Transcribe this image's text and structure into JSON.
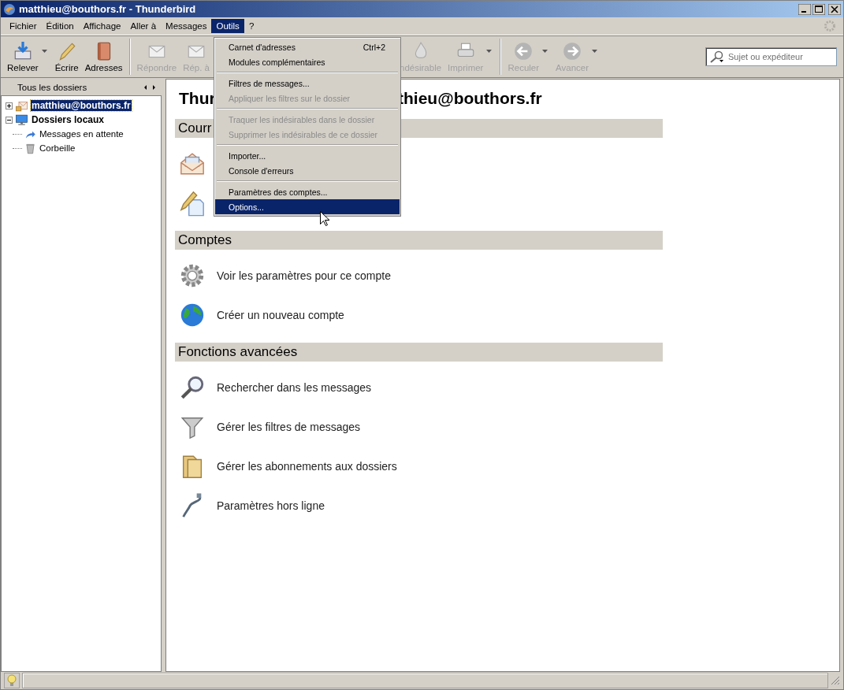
{
  "window": {
    "title": "matthieu@bouthors.fr - Thunderbird"
  },
  "menu_bar": [
    {
      "label": "Fichier",
      "selected": false
    },
    {
      "label": "Édition",
      "selected": false
    },
    {
      "label": "Affichage",
      "selected": false
    },
    {
      "label": "Aller à",
      "selected": false
    },
    {
      "label": "Messages",
      "selected": false
    },
    {
      "label": "Outils",
      "selected": true
    },
    {
      "label": "?",
      "selected": false
    }
  ],
  "toolbar_left": [
    {
      "label": "Relever",
      "kind": "get",
      "disabled": false,
      "dropdown": true,
      "separator_before": false
    },
    {
      "label": "Écrire",
      "kind": "write",
      "disabled": false,
      "dropdown": false,
      "separator_before": false
    },
    {
      "label": "Adresses",
      "kind": "book",
      "disabled": false,
      "dropdown": false,
      "separator_before": false
    },
    {
      "label": "Répondre",
      "kind": "reply",
      "disabled": true,
      "dropdown": false,
      "separator_before": true
    },
    {
      "label": "Rép. à",
      "kind": "reply",
      "disabled": true,
      "dropdown": false,
      "separator_before": false
    }
  ],
  "toolbar_right": [
    {
      "label": "ndésirable",
      "kind": "junk",
      "disabled": true,
      "dropdown": false,
      "separator_before": false
    },
    {
      "label": "Imprimer",
      "kind": "print",
      "disabled": true,
      "dropdown": true,
      "separator_before": false
    },
    {
      "label": "Reculer",
      "kind": "back",
      "disabled": true,
      "dropdown": true,
      "separator_before": true
    },
    {
      "label": "Avancer",
      "kind": "forward",
      "disabled": true,
      "dropdown": true,
      "separator_before": false
    }
  ],
  "search": {
    "placeholder": "Sujet ou expéditeur"
  },
  "folder_pane": {
    "header": "Tous les dossiers",
    "tree": [
      {
        "label": "matthieu@bouthors.fr",
        "kind": "account",
        "expanded": false,
        "selected": true
      },
      {
        "label": "Dossiers locaux",
        "kind": "local",
        "expanded": true,
        "selected": false,
        "children": [
          {
            "label": "Messages en attente",
            "kind": "outbox",
            "selected": false
          },
          {
            "label": "Corbeille",
            "kind": "trash",
            "selected": false
          }
        ]
      }
    ]
  },
  "main": {
    "title_parts": [
      "Thur",
      "thieu@bouthors.fr"
    ],
    "sections": [
      {
        "title": "Courr",
        "items": [
          {
            "kind": "mail"
          },
          {
            "kind": "compose"
          }
        ]
      },
      {
        "title": "Comptes",
        "items": [
          {
            "kind": "gear",
            "label": "Voir les paramètres pour ce compte"
          },
          {
            "kind": "globe",
            "label": "Créer un nouveau compte"
          }
        ]
      },
      {
        "title": "Fonctions avancées",
        "items": [
          {
            "kind": "search",
            "label": "Rechercher dans les messages"
          },
          {
            "kind": "filter",
            "label": "Gérer les filtres de messages"
          },
          {
            "kind": "folder",
            "label": "Gérer les abonnements aux dossiers"
          },
          {
            "kind": "offline",
            "label": "Paramètres hors ligne"
          }
        ]
      }
    ]
  },
  "tools_menu": {
    "groups": [
      [
        {
          "label": "Carnet d'adresses",
          "shortcut": "Ctrl+2",
          "disabled": false,
          "selected": false
        },
        {
          "label": "Modules complémentaires",
          "disabled": false,
          "selected": false
        }
      ],
      [
        {
          "label": "Filtres de messages...",
          "disabled": false,
          "selected": false
        },
        {
          "label": "Appliquer les filtres sur le dossier",
          "disabled": true,
          "selected": false
        }
      ],
      [
        {
          "label": "Traquer les indésirables dans le dossier",
          "disabled": true,
          "selected": false
        },
        {
          "label": "Supprimer les indésirables de ce dossier",
          "disabled": true,
          "selected": false
        }
      ],
      [
        {
          "label": "Importer...",
          "disabled": false,
          "selected": false
        },
        {
          "label": "Console d'erreurs",
          "disabled": false,
          "selected": false
        }
      ],
      [
        {
          "label": "Paramètres des comptes...",
          "disabled": false,
          "selected": false
        },
        {
          "label": "Options...",
          "disabled": false,
          "selected": true
        }
      ]
    ]
  }
}
